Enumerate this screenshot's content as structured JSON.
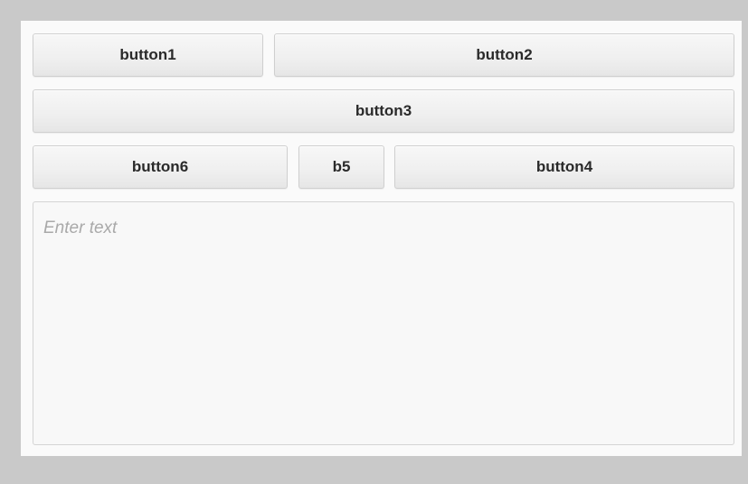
{
  "row1": {
    "button1_label": "button1",
    "button2_label": "button2"
  },
  "row2": {
    "button3_label": "button3"
  },
  "row3": {
    "button6_label": "button6",
    "b5_label": "b5",
    "button4_label": "button4"
  },
  "text_area": {
    "value": "",
    "placeholder": "Enter text"
  }
}
